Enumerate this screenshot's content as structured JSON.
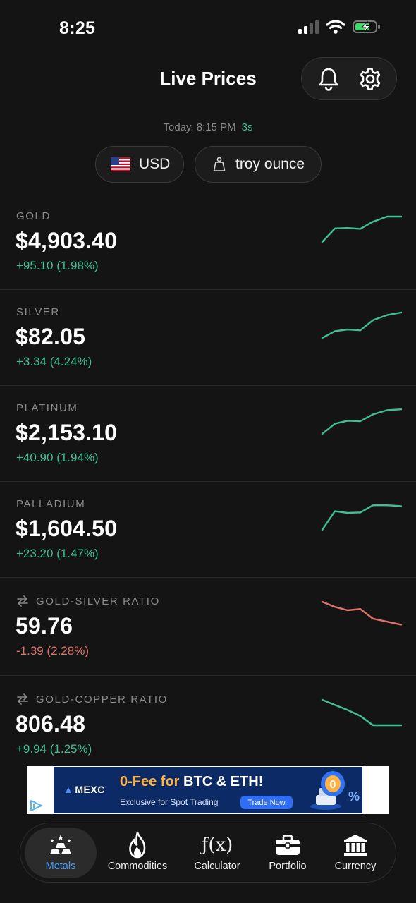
{
  "status_bar": {
    "time": "8:25"
  },
  "header": {
    "title": "Live Prices",
    "bell_icon": "bell-icon",
    "settings_icon": "gear-icon"
  },
  "update": {
    "label": "Today, 8:15 PM",
    "age": "3s"
  },
  "filters": {
    "currency": {
      "label": "USD",
      "icon": "us-flag-icon"
    },
    "unit": {
      "label": "troy ounce",
      "icon": "weight-icon"
    }
  },
  "colors": {
    "up": "#3fbf95",
    "down": "#e0726a",
    "accent": "#4a9df2"
  },
  "metals": [
    {
      "name": "GOLD",
      "price": "$4,903.40",
      "change": "+95.10 (1.98%)",
      "direction": "up",
      "trend": [
        2,
        5.2,
        5.3,
        5.1,
        6.8,
        8,
        8
      ]
    },
    {
      "name": "SILVER",
      "price": "$82.05",
      "change": "+3.34 (4.24%)",
      "direction": "up",
      "trend": [
        2,
        3.6,
        4.0,
        3.8,
        6.2,
        7.4,
        8
      ]
    },
    {
      "name": "PLATINUM",
      "price": "$2,153.10",
      "change": "+40.90 (1.94%)",
      "direction": "up",
      "trend": [
        2,
        4.4,
        5.1,
        5.0,
        6.6,
        7.6,
        7.8
      ]
    },
    {
      "name": "PALLADIUM",
      "price": "$1,604.50",
      "change": "+23.20 (1.47%)",
      "direction": "up",
      "trend": [
        2,
        6.4,
        6.0,
        6.1,
        7.8,
        7.8,
        7.6
      ]
    },
    {
      "name": "GOLD-SILVER RATIO",
      "price": "59.76",
      "change": "-1.39 (2.28%)",
      "direction": "down",
      "ratio": true,
      "trend": [
        8,
        6.8,
        6.0,
        6.3,
        4.0,
        3.3,
        2.6
      ]
    },
    {
      "name": "GOLD-COPPER RATIO",
      "price": "806.48",
      "change": "+9.94 (1.25%)",
      "direction": "up",
      "ratio": true,
      "trend": [
        8,
        6.8,
        5.6,
        4.2,
        2.0,
        2.0,
        2.0
      ]
    }
  ],
  "ad": {
    "brand": "MEXC",
    "headline_highlight": "0-Fee for",
    "headline_rest": "BTC & ETH!",
    "subtitle": "Exclusive for Spot Trading",
    "cta": "Trade Now"
  },
  "tabs": [
    {
      "id": "metals",
      "label": "Metals",
      "icon": "gold-bars-icon",
      "active": true
    },
    {
      "id": "commodities",
      "label": "Commodities",
      "icon": "flame-icon",
      "active": false
    },
    {
      "id": "calculator",
      "label": "Calculator",
      "icon": "function-icon",
      "glyph": "ƒ(x)",
      "active": false
    },
    {
      "id": "portfolio",
      "label": "Portfolio",
      "icon": "briefcase-icon",
      "active": false
    },
    {
      "id": "currency",
      "label": "Currency",
      "icon": "bank-icon",
      "active": false
    }
  ]
}
